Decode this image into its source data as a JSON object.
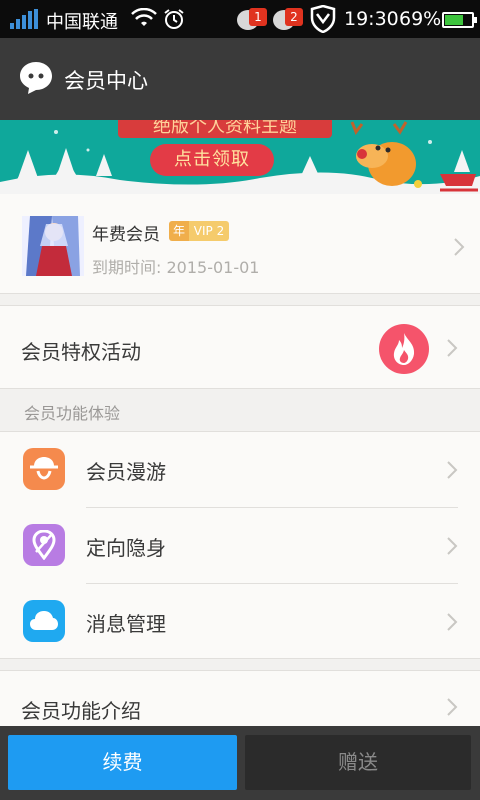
{
  "status_bar": {
    "carrier": "中国联通",
    "time": "19:30",
    "battery_percent": "69%",
    "battery_level": 0.69,
    "notifications": [
      {
        "icon": "message-bubble-icon",
        "count": "1"
      },
      {
        "icon": "message-bubble-icon",
        "count": "2"
      }
    ],
    "icons": [
      "signal-icon",
      "wifi-icon",
      "alarm-icon",
      "shield-icon",
      "battery-icon"
    ]
  },
  "header": {
    "title": "会员中心",
    "logo_icon": "chat-bubble-icon"
  },
  "banner": {
    "headline": "绝版个人资料主题",
    "cta": "点击领取"
  },
  "member": {
    "type": "年费会员",
    "badge_year": "年",
    "badge_vip": "VIP 2",
    "expire_label": "到期时间:",
    "expire_date": "2015-01-01",
    "expire_text": "到期时间:  2015-01-01"
  },
  "privilege": {
    "label": "会员特权活动",
    "icon": "flame-icon",
    "icon_color": "#f5546b"
  },
  "features": {
    "header": "会员功能体验",
    "items": [
      {
        "label": "会员漫游",
        "icon": "roaming-icon",
        "color": "#f58a4d"
      },
      {
        "label": "定向隐身",
        "icon": "location-hide-icon",
        "color": "#b87ce3"
      },
      {
        "label": "消息管理",
        "icon": "cloud-icon",
        "color": "#1fa9f0"
      }
    ]
  },
  "intro": {
    "label": "会员功能介绍"
  },
  "footer": {
    "renew_label": "续费",
    "gift_label": "赠送"
  },
  "colors": {
    "accent_blue": "#1e9bf2",
    "header_bg": "#3a3a3a",
    "badge_gold": "#f5cb6c"
  }
}
